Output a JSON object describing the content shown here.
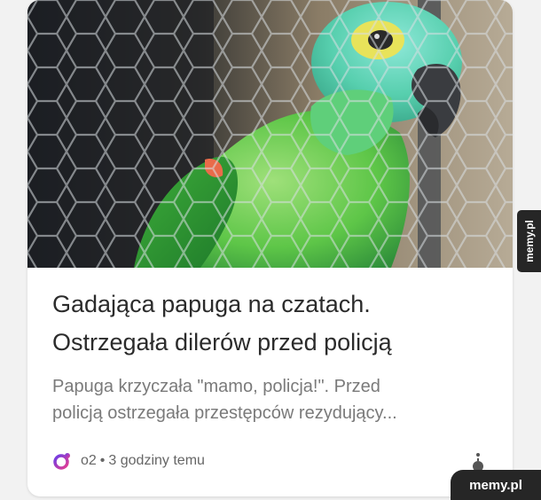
{
  "article": {
    "title_line1": "Gadająca papuga na czatach.",
    "title_line2": "Ostrzegała dilerów przed policją",
    "snippet_line1": "Papuga krzyczała \"mamo, policja!\". Przed",
    "snippet_line2": "policją ostrzegała przestępców rezydujący...",
    "source": "o2",
    "separator": "•",
    "time": "3 godziny temu",
    "source_icon": "o2-logo-icon",
    "more_icon": "more-options-icon",
    "image_subject": "parrot-photo"
  },
  "watermark": {
    "side": "memy.pl",
    "corner": "memy.pl"
  },
  "colors": {
    "title": "#2b2b2b",
    "snippet": "#7a7a7a",
    "meta": "#666666",
    "logo_gradient": [
      "#6a3de8",
      "#e83d8f"
    ],
    "watermark_bg": "#262626"
  }
}
